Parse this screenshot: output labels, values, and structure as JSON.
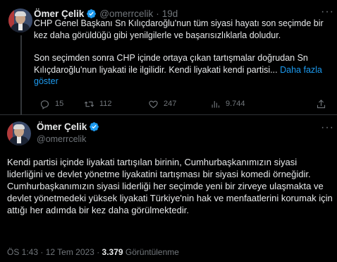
{
  "tweet1": {
    "name": "Ömer Çelik",
    "handle": "@omerrcelik",
    "separator": "·",
    "time": "19d",
    "more_icon": "more-horizontal-icon",
    "para1": "CHP Genel Başkanı Sn Kılıçdaroğlu'nun tüm siyasi hayatı son seçimde bir kez daha görüldüğü gibi yenilgilerle ve başarısızlıklarla doludur.",
    "para2": "Son seçimden sonra CHP içinde ortaya çıkan tartışmalar doğrudan Sn Kılıçdaroğlu'nun liyakati ile ilgilidir. Kendi liyakati kendi partisi...",
    "show_more": "Daha fazla göster",
    "replies": "15",
    "retweets": "112",
    "likes": "247",
    "views": "9.744",
    "accent_color": "#1d9bf0"
  },
  "tweet2": {
    "name": "Ömer Çelik",
    "handle": "@omerrcelik",
    "para1": "Kendi partisi içinde  liyakati tartışılan birinin, Cumhurbaşkanımızın siyasi liderliğini ve devlet yönetme liyakatini tartışması bir siyasi komedi örneğidir.",
    "para2": "Cumhurbaşkanımızın siyasi liderliği her seçimde yeni bir zirveye ulaşmakta ve  devlet yönetmedeki yüksek liyakati Türkiye'nin hak ve menfaatlerini korumak için attığı her adımda bir kez daha görülmektedir.",
    "timestamp": "ÖS 1:43 · 12 Tem 2023 · ",
    "views_count": "3.379",
    "views_label": " Görüntülenme"
  }
}
